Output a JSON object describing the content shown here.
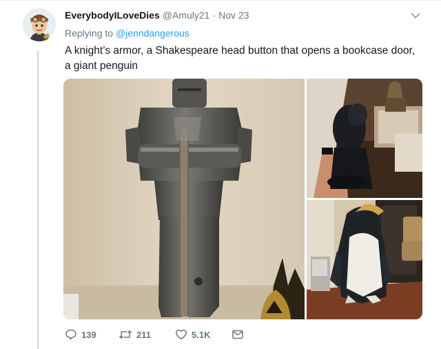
{
  "tweet": {
    "display_name": "EverybodyILoveDies",
    "handle": "@Amuly21",
    "separator": "·",
    "timestamp": "Nov 23",
    "reply_prefix": "Replying to",
    "reply_to": "@jenndangerous",
    "text": "A knight’s armor, a Shakespeare head button that opens a bookcase door, a giant penguin"
  },
  "media": {
    "images": [
      {
        "subject": "knight's armor"
      },
      {
        "subject": "Shakespeare head button"
      },
      {
        "subject": "giant penguin"
      }
    ]
  },
  "actions": {
    "reply_count": "139",
    "retweet_count": "211",
    "like_count": "5.1K"
  },
  "colors": {
    "accent": "#1da1f2",
    "text_primary": "#14171a",
    "text_secondary": "#657786",
    "thread_line": "#cfd9de"
  },
  "icons": {
    "reply": "reply-icon",
    "retweet": "retweet-icon",
    "like": "heart-icon",
    "message": "envelope-icon",
    "menu": "chevron-down-icon"
  }
}
